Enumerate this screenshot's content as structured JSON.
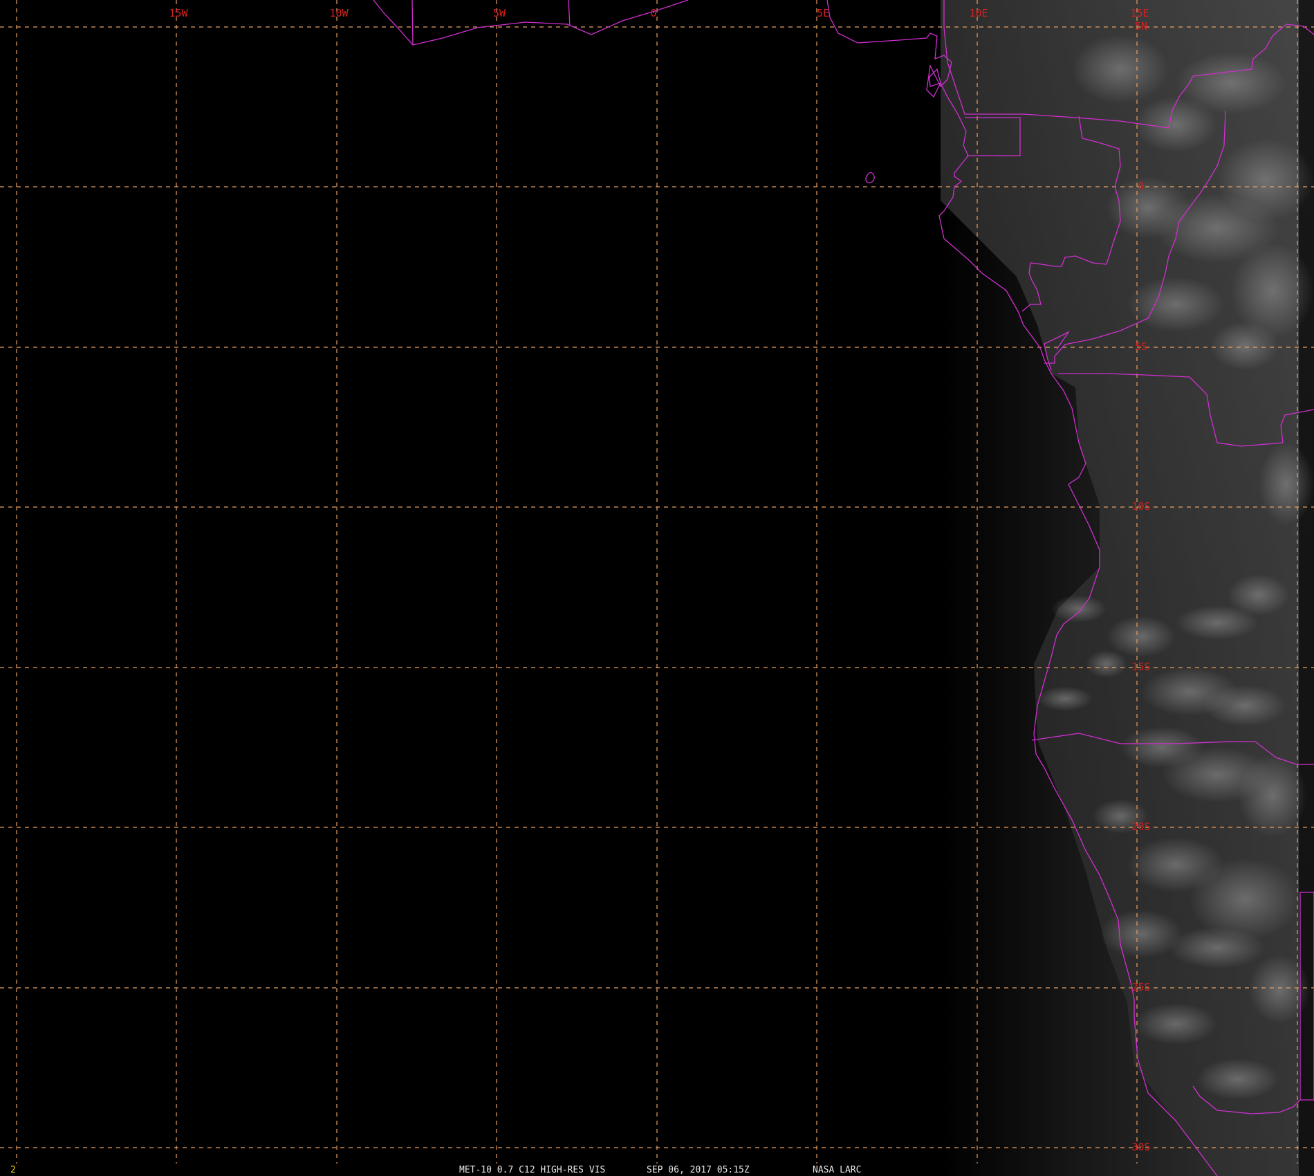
{
  "frame_number": "2",
  "caption": {
    "product": "MET-10 0.7 C12 HIGH-RES VIS",
    "datetime": "SEP 06, 2017 05:15Z",
    "source": "NASA LARC"
  },
  "colors": {
    "background": "#000000",
    "grid": "#e8a060",
    "grid_label": "#d42020",
    "boundaries": "#d030d0",
    "frame_number": "#e6d200",
    "caption": "#e8e8e8"
  },
  "grid": {
    "longitude_labels": [
      "15W",
      "10W",
      "5W",
      "0",
      "5E",
      "10E",
      "15E"
    ],
    "latitude_labels": [
      "5N",
      "0",
      "5S",
      "10S",
      "15S",
      "20S",
      "25S",
      "30S"
    ]
  },
  "imagery": {
    "description_words": "visible satellite imagery, dark ocean, sunlit land",
    "features": [
      "west-central-africa-coastline",
      "country-borders",
      "clouds"
    ]
  }
}
